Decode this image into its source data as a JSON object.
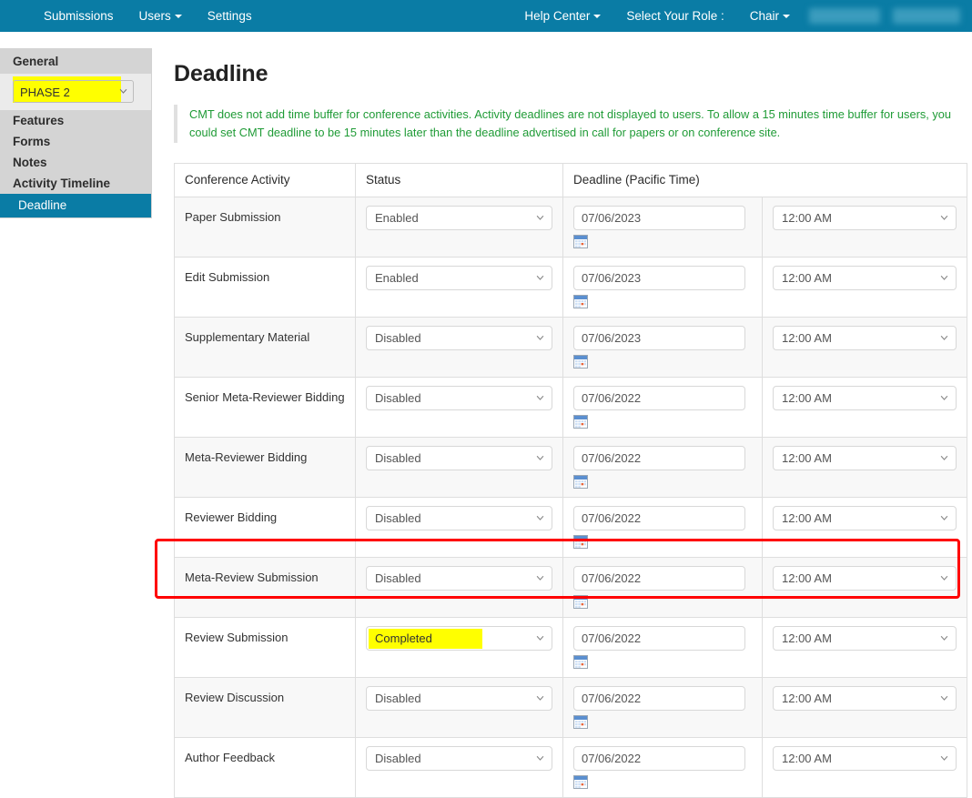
{
  "navbar": {
    "background_color": "#0a7ca5",
    "left_items": [
      {
        "label": "Submissions",
        "has_caret": false,
        "icon": ""
      },
      {
        "label": "Users",
        "has_caret": true,
        "icon": "chevron-down-icon"
      },
      {
        "label": "Settings",
        "has_caret": false,
        "icon": ""
      }
    ],
    "right_items": [
      {
        "label": "Help Center",
        "has_caret": true,
        "icon": "chevron-down-icon"
      },
      {
        "label": "Select Your Role :",
        "has_caret": false,
        "icon": ""
      },
      {
        "label": "Chair",
        "has_caret": true,
        "icon": "chevron-down-icon"
      }
    ],
    "redacted_count": 2
  },
  "sidebar": {
    "section_title": "General",
    "phase_select": {
      "value": "PHASE 2",
      "highlight_color": "#ffff00",
      "options": [
        "PHASE 2"
      ]
    },
    "links": [
      {
        "label": "Features"
      },
      {
        "label": "Forms"
      },
      {
        "label": "Notes"
      },
      {
        "label": "Activity Timeline"
      }
    ],
    "active_item": {
      "label": "Deadline",
      "color": "#0a7ca5"
    }
  },
  "main": {
    "page_title": "Deadline",
    "notice": "CMT does not add time buffer for conference activities. Activity deadlines are not displayed to users. To allow a 15 minutes time buffer for users, you could set CMT deadline to be 15 minutes later than the deadline advertised in call for papers or on conference site.",
    "notice_color": "#1f9b36",
    "table": {
      "headers": [
        "Conference Activity",
        "Status",
        "Deadline (Pacific Time)"
      ],
      "rows": [
        {
          "activity": "Paper Submission",
          "status": "Enabled",
          "date": "07/06/2023",
          "time": "12:00 AM",
          "highlighted": false
        },
        {
          "activity": "Edit Submission",
          "status": "Enabled",
          "date": "07/06/2023",
          "time": "12:00 AM",
          "highlighted": false
        },
        {
          "activity": "Supplementary Material",
          "status": "Disabled",
          "date": "07/06/2023",
          "time": "12:00 AM",
          "highlighted": false
        },
        {
          "activity": "Senior Meta-Reviewer Bidding",
          "status": "Disabled",
          "date": "07/06/2022",
          "time": "12:00 AM",
          "highlighted": false
        },
        {
          "activity": "Meta-Reviewer Bidding",
          "status": "Disabled",
          "date": "07/06/2022",
          "time": "12:00 AM",
          "highlighted": false
        },
        {
          "activity": "Reviewer Bidding",
          "status": "Disabled",
          "date": "07/06/2022",
          "time": "12:00 AM",
          "highlighted": false
        },
        {
          "activity": "Meta-Review Submission",
          "status": "Disabled",
          "date": "07/06/2022",
          "time": "12:00 AM",
          "highlighted": false
        },
        {
          "activity": "Review Submission",
          "status": "Completed",
          "date": "07/06/2022",
          "time": "12:00 AM",
          "highlighted": true
        },
        {
          "activity": "Review Discussion",
          "status": "Disabled",
          "date": "07/06/2022",
          "time": "12:00 AM",
          "highlighted": false
        },
        {
          "activity": "Author Feedback",
          "status": "Disabled",
          "date": "07/06/2022",
          "time": "12:00 AM",
          "highlighted": false
        }
      ],
      "status_options": [
        "Enabled",
        "Disabled",
        "Completed"
      ],
      "time_options": [
        "12:00 AM"
      ]
    }
  },
  "annotation": {
    "red_box_color": "#ff0000",
    "target_row": "Review Submission"
  }
}
